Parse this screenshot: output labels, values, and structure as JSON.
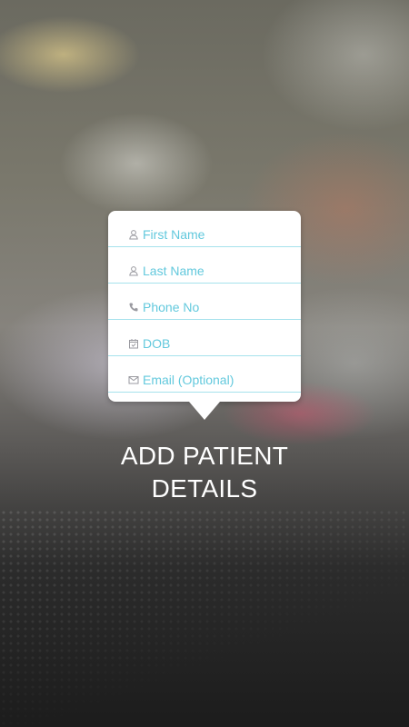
{
  "form": {
    "fields": [
      {
        "label": "First Name",
        "icon": "person-icon"
      },
      {
        "label": "Last Name",
        "icon": "person-icon"
      },
      {
        "label": "Phone No",
        "icon": "phone-icon"
      },
      {
        "label": "DOB",
        "icon": "calendar-icon"
      },
      {
        "label": "Email (Optional)",
        "icon": "mail-icon"
      }
    ]
  },
  "headline": {
    "line1": "ADD PATIENT",
    "line2": "DETAILS"
  },
  "colors": {
    "accent": "#63c9dd",
    "divider": "#a6e2ec",
    "icon": "#9a9aa0",
    "text": "#ffffff"
  }
}
